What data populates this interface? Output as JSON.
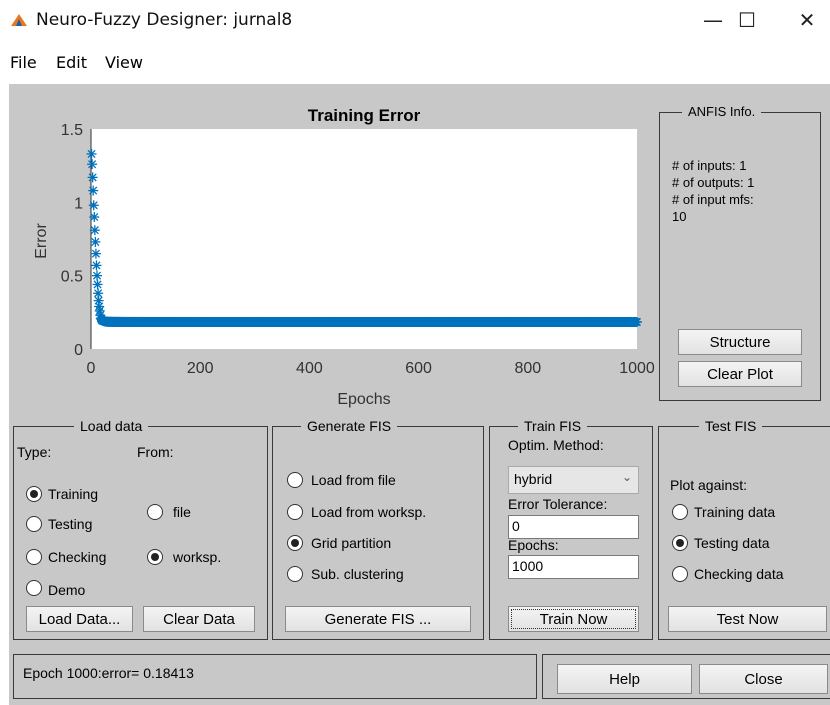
{
  "window": {
    "title": "Neuro-Fuzzy Designer: jurnal8",
    "minimize": "—",
    "maximize": "☐",
    "close": "✕"
  },
  "menu": [
    "File",
    "Edit",
    "View"
  ],
  "plot": {
    "title": "Training Error",
    "ylabel": "Error",
    "xlabel": "Epochs",
    "yticks": [
      "1.5",
      "1",
      "0.5",
      "0"
    ],
    "xticks": [
      "0",
      "200",
      "400",
      "600",
      "800",
      "1000"
    ]
  },
  "chart_data": {
    "type": "scatter",
    "title": "Training Error",
    "xlabel": "Epochs",
    "ylabel": "Error",
    "xlim": [
      0,
      1000
    ],
    "ylim": [
      0,
      1.5
    ],
    "grid": false,
    "marker": "asterisk",
    "color": "#0072BD",
    "series": [
      {
        "x": [
          1,
          2,
          3,
          4,
          5,
          6,
          7,
          8,
          9,
          10,
          11,
          12,
          13,
          14,
          15,
          16,
          17,
          18,
          20,
          25,
          30,
          40,
          60,
          100,
          200,
          400,
          600,
          800,
          1000
        ],
        "y": [
          1.33,
          1.26,
          1.17,
          1.08,
          0.98,
          0.9,
          0.81,
          0.73,
          0.65,
          0.57,
          0.5,
          0.44,
          0.38,
          0.33,
          0.29,
          0.26,
          0.23,
          0.21,
          0.195,
          0.188,
          0.186,
          0.185,
          0.1845,
          0.1843,
          0.1842,
          0.1842,
          0.18415,
          0.18414,
          0.18413
        ]
      }
    ]
  },
  "anfis": {
    "title": "ANFIS Info.",
    "inputs": "# of inputs: 1",
    "outputs": "# of outputs: 1",
    "mfs": "# of input mfs:",
    "mfs_value": "10",
    "structure": "Structure",
    "clear_plot": "Clear Plot"
  },
  "load": {
    "title": "Load data",
    "type_label": "Type:",
    "from_label": "From:",
    "types": [
      "Training",
      "Testing",
      "Checking",
      "Demo"
    ],
    "from": [
      "file",
      "worksp."
    ],
    "load_button": "Load Data...",
    "clear_button": "Clear Data"
  },
  "generate": {
    "title": "Generate FIS",
    "options": [
      "Load from file",
      "Load from worksp.",
      "Grid partition",
      "Sub. clustering"
    ],
    "button": "Generate FIS ..."
  },
  "train": {
    "title": "Train FIS",
    "method_label": "Optim. Method:",
    "method": "hybrid",
    "tol_label": "Error Tolerance:",
    "tol": "0",
    "epochs_label": "Epochs:",
    "epochs": "1000",
    "button": "Train Now"
  },
  "test": {
    "title": "Test FIS",
    "plot_label": "Plot against:",
    "options": [
      "Training data",
      "Testing data",
      "Checking data"
    ],
    "button": "Test Now"
  },
  "status": "Epoch 1000:error= 0.18413",
  "help": "Help",
  "close": "Close"
}
